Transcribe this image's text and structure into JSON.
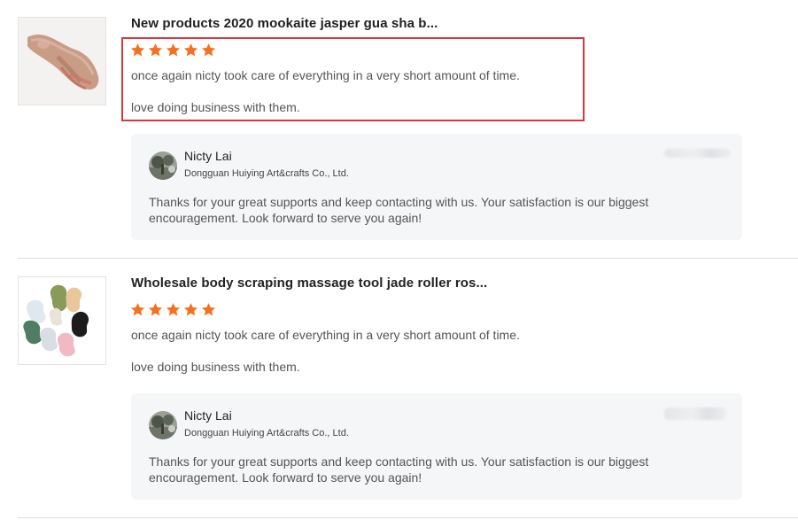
{
  "reviews": [
    {
      "product_title": "New products 2020 mookaite jasper gua sha b...",
      "rating": 5,
      "highlighted": true,
      "comment_lines": [
        "once again nicty took care of everything in a very short amount of time.",
        "love doing business with them."
      ],
      "reply": {
        "seller_name": "Nicty Lai",
        "company": "Dongguan Huiying Art&crafts Co., Ltd.",
        "text": "Thanks for your great supports and keep contacting with us. Your satisfaction is our biggest encouragement. Look forward to serve you again!"
      }
    },
    {
      "product_title": "Wholesale body scraping massage tool jade roller ros...",
      "rating": 5,
      "highlighted": false,
      "comment_lines": [
        "once again nicty took care of everything in a very short amount of time.",
        "love doing business with them."
      ],
      "reply": {
        "seller_name": "Nicty Lai",
        "company": "Dongguan Huiying Art&crafts Co., Ltd.",
        "text": "Thanks for your great supports and keep contacting with us. Your satisfaction is our biggest encouragement. Look forward to serve you again!"
      }
    }
  ],
  "colors": {
    "star": "#f5701f",
    "highlight_border": "#d9363e",
    "reply_background": "#f5f6f8"
  },
  "icons": [
    "star-icon",
    "product-thumbnail",
    "seller-avatar"
  ]
}
